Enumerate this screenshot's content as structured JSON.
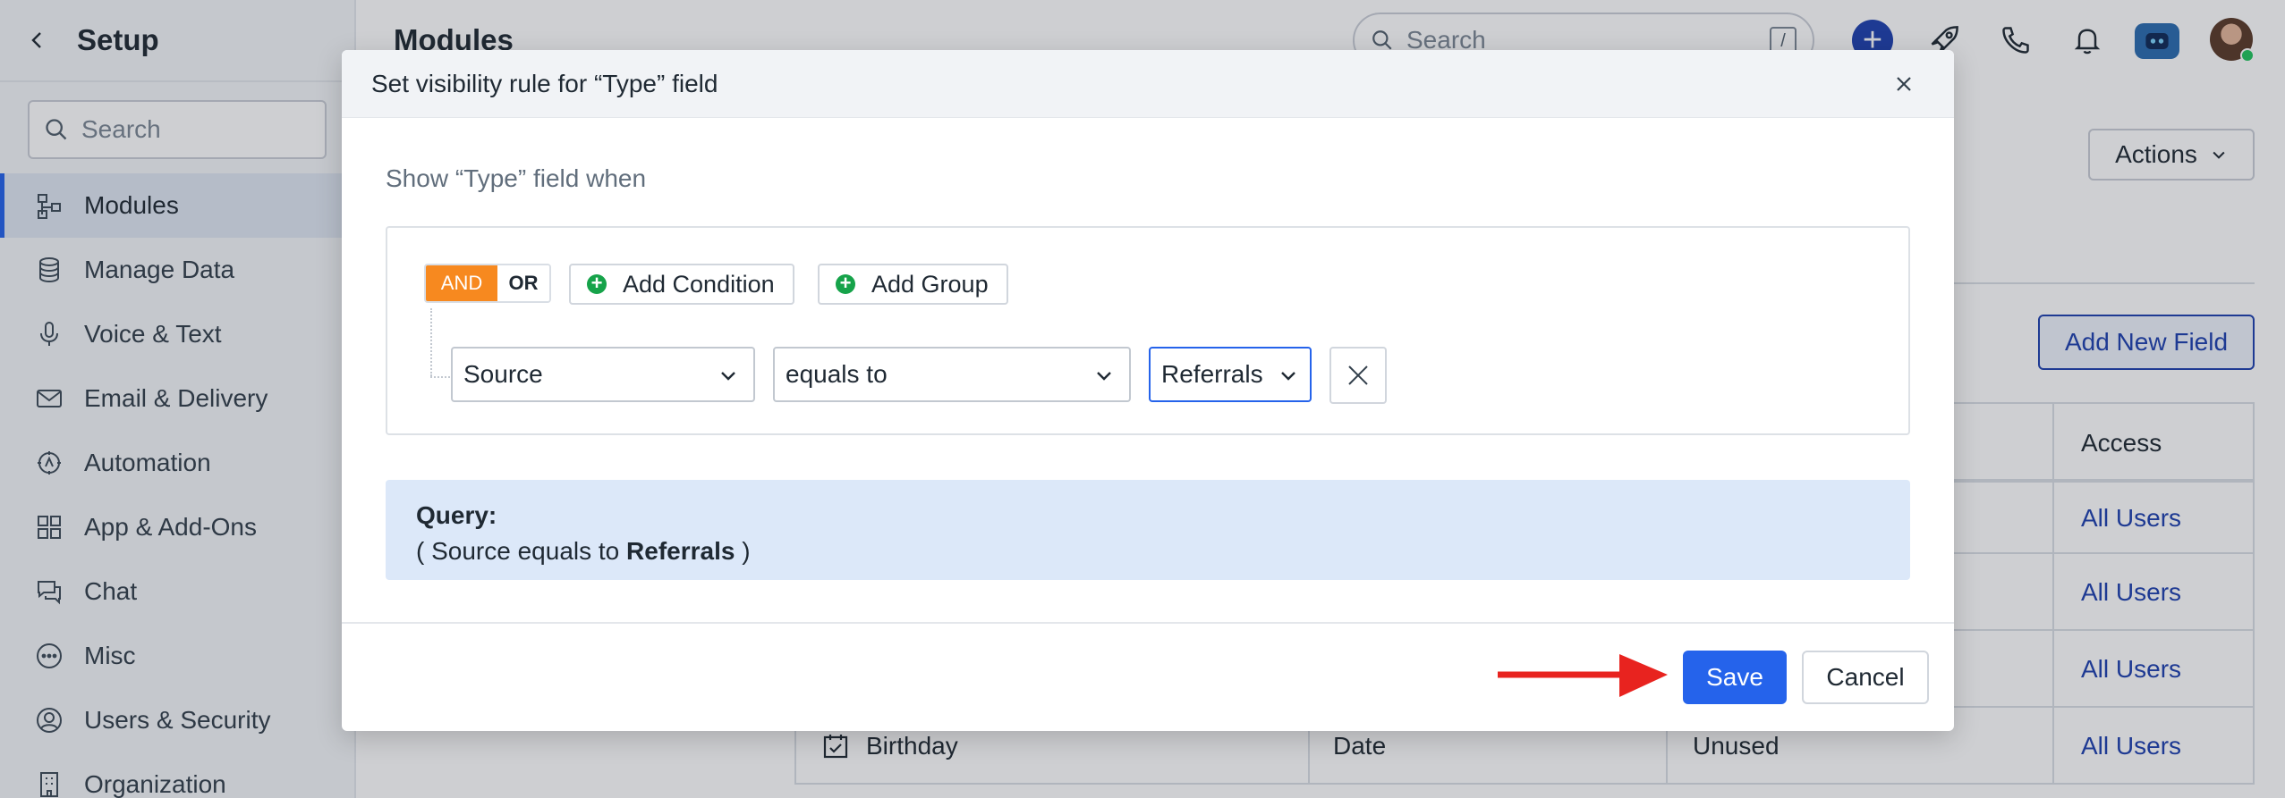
{
  "sidebar": {
    "title": "Setup",
    "search_placeholder": "Search",
    "items": [
      {
        "label": "Modules",
        "icon": "modules-icon",
        "active": true
      },
      {
        "label": "Manage Data",
        "icon": "database-icon"
      },
      {
        "label": "Voice & Text",
        "icon": "microphone-icon"
      },
      {
        "label": "Email & Delivery",
        "icon": "envelope-icon"
      },
      {
        "label": "Automation",
        "icon": "automation-icon"
      },
      {
        "label": "App & Add-Ons",
        "icon": "grid-icon"
      },
      {
        "label": "Chat",
        "icon": "chat-icon"
      },
      {
        "label": "Misc",
        "icon": "more-circle-icon"
      },
      {
        "label": "Users & Security",
        "icon": "user-circle-icon"
      },
      {
        "label": "Organization",
        "icon": "building-icon"
      }
    ]
  },
  "header": {
    "page_title": "Modules",
    "search_placeholder": "Search",
    "search_shortcut": "/"
  },
  "main": {
    "actions_label": "Actions",
    "add_field_label": "Add New Field",
    "table": {
      "access_header": "Access",
      "rows": [
        {
          "name": "",
          "type": "",
          "status": "",
          "access": "All Users"
        },
        {
          "name": "",
          "type": "",
          "status": "",
          "access": "All Users"
        },
        {
          "name": "",
          "type": "",
          "status": "",
          "access": "All Users"
        },
        {
          "name": "Birthday",
          "type": "Date",
          "status": "Unused",
          "access": "All Users"
        }
      ]
    }
  },
  "modal": {
    "title": "Set visibility rule for “Type” field",
    "show_when": "Show “Type” field when",
    "toggle_and": "AND",
    "toggle_or": "OR",
    "add_condition": "Add Condition",
    "add_group": "Add Group",
    "condition": {
      "field": "Source",
      "operator": "equals to",
      "value": "Referrals"
    },
    "query_label": "Query:",
    "query_prefix": "( Source equals to",
    "query_value": "Referrals",
    "query_suffix": ")",
    "save_label": "Save",
    "cancel_label": "Cancel"
  },
  "colors": {
    "primary": "#2563eb",
    "and_toggle": "#f7891f",
    "add_icon": "#16a34a",
    "query_bg": "#dce8f9",
    "annotation_arrow": "#e8231f"
  }
}
